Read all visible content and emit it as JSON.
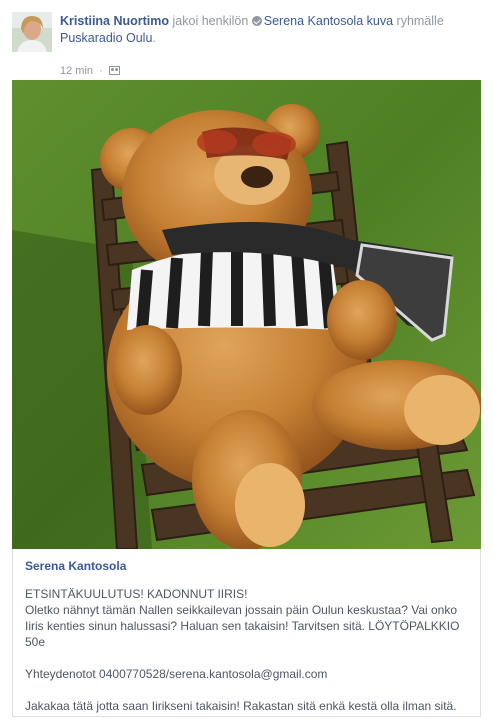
{
  "post": {
    "actor_name": "Kristiina Nuortimo",
    "shared_text": "jakoi henkilön",
    "original_author": "Serena Kantosola",
    "photo_link": "kuva",
    "group_text": "ryhmälle",
    "group_name": "Puskaradio Oulu",
    "period": ".",
    "timestamp": "12 min",
    "separator": "·",
    "shared_icon": "verified-share-icon",
    "audience_icon": "group-icon"
  },
  "attachment": {
    "author": "Serena Kantosola",
    "paragraphs": [
      "ETSINTÄKUULUTUS! KADONNUT IIRIS!",
      "Oletko nähnyt tämän Nallen seikkailevan jossain päin Oulun keskustaa? Vai onko Iiris kenties sinun halussasi? Haluan sen takaisin! Tarvitsen sitä. LÖYTÖPALKKIO 50e",
      "Yhteydenotot 0400770528/serena.kantosola@gmail.com",
      "Jakakaa tätä jotta saan Iirikseni takaisin! Rakastan sitä enkä kestä olla ilman sitä."
    ]
  },
  "colors": {
    "link": "#3b5998",
    "muted": "#9197a3",
    "body_text": "#4e5665",
    "border": "#dddfe2"
  }
}
